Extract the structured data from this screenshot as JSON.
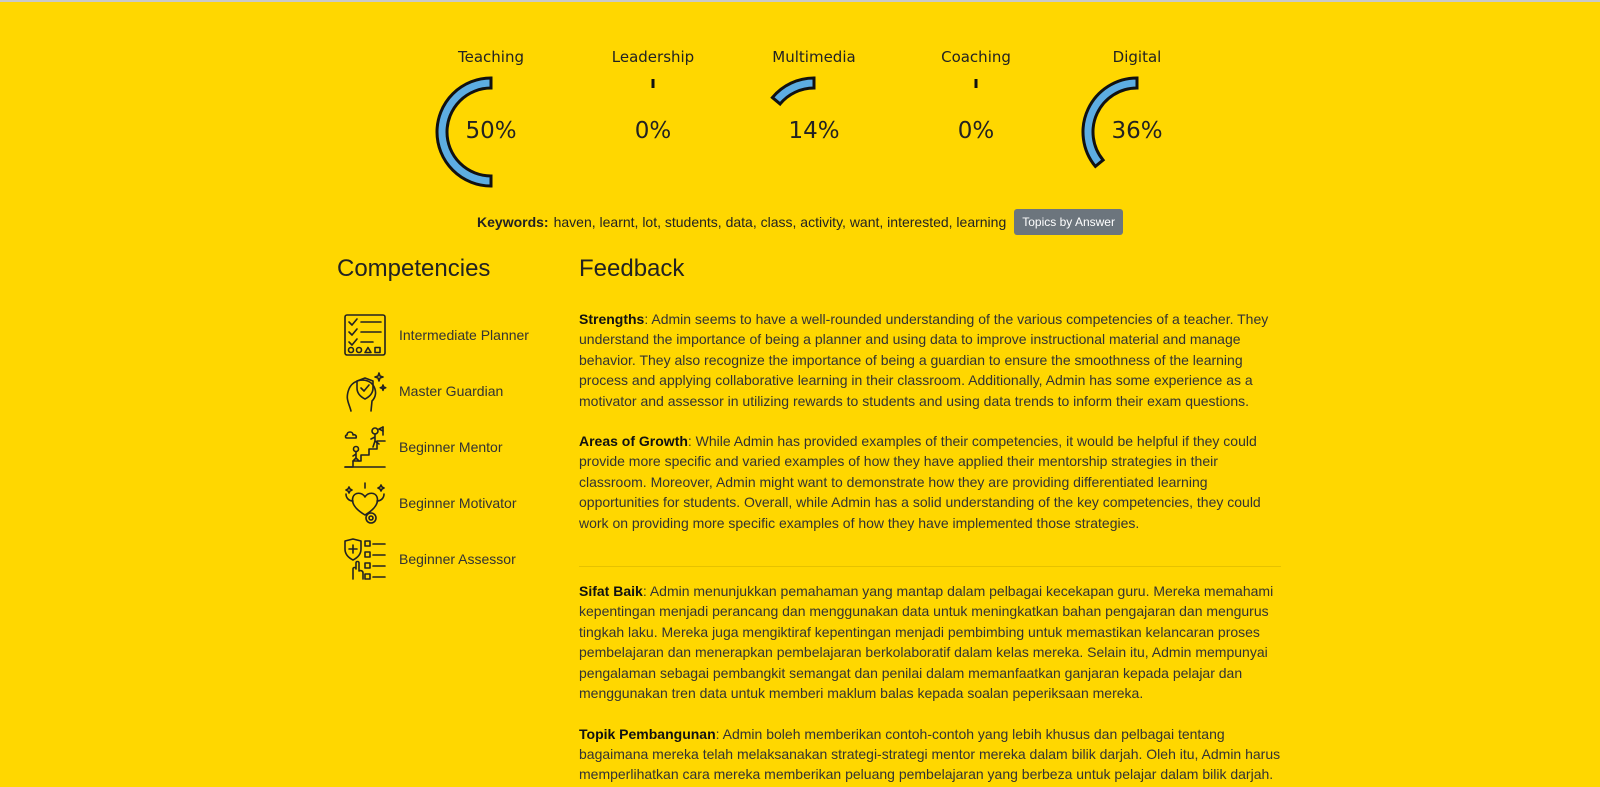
{
  "gauges": [
    {
      "label": "Teaching",
      "value_text": "50%",
      "percent": 50
    },
    {
      "label": "Leadership",
      "value_text": "0%",
      "percent": 0
    },
    {
      "label": "Multimedia",
      "value_text": "14%",
      "percent": 14
    },
    {
      "label": "Coaching",
      "value_text": "0%",
      "percent": 0
    },
    {
      "label": "Digital",
      "value_text": "36%",
      "percent": 36
    }
  ],
  "keywords": {
    "label": "Keywords:",
    "text": "haven, learnt, lot, students, data, class, activity, want, interested, learning",
    "button_label": "Topics by Answer"
  },
  "competencies": {
    "title": "Competencies",
    "items": [
      {
        "label": "Intermediate Planner",
        "icon": "planner-checklist-icon"
      },
      {
        "label": "Master Guardian",
        "icon": "guardian-shield-icon"
      },
      {
        "label": "Beginner Mentor",
        "icon": "mentor-climb-icon"
      },
      {
        "label": "Beginner Motivator",
        "icon": "motivator-icon"
      },
      {
        "label": "Beginner Assessor",
        "icon": "assessor-checklist-icon"
      }
    ]
  },
  "feedback": {
    "title": "Feedback",
    "strengths_label": "Strengths",
    "strengths_text": ": Admin seems to have a well-rounded understanding of the various competencies of a teacher. They understand the importance of being a planner and using data to improve instructional material and manage behavior. They also recognize the importance of being a guardian to ensure the smoothness of the learning process and applying collaborative learning in their classroom. Additionally, Admin has some experience as a motivator and assessor in utilizing rewards to students and using data trends to inform their exam questions.",
    "growth_label": "Areas of Growth",
    "growth_text": ": While Admin has provided examples of their competencies, it would be helpful if they could provide more specific and varied examples of how they have applied their mentorship strategies in their classroom. Moreover, Admin might want to demonstrate how they are providing differentiated learning opportunities for students. Overall, while Admin has a solid understanding of the key competencies, they could work on providing more specific examples of how they have implemented those strategies.",
    "sifat_label": "Sifat Baik",
    "sifat_text": ": Admin menunjukkan pemahaman yang mantap dalam pelbagai kecekapan guru. Mereka memahami kepentingan menjadi perancang dan menggunakan data untuk meningkatkan bahan pengajaran dan mengurus tingkah laku. Mereka juga mengiktiraf kepentingan menjadi pembimbing untuk memastikan kelancaran proses pembelajaran dan menerapkan pembelajaran berkolaboratif dalam kelas mereka. Selain itu, Admin mempunyai pengalaman sebagai pembangkit semangat dan penilai dalam memanfaatkan ganjaran kepada pelajar dan menggunakan tren data untuk memberi maklum balas kepada soalan peperiksaan mereka.",
    "topik_label": "Topik Pembangunan",
    "topik_text": ": Admin boleh memberikan contoh-contoh yang lebih khusus dan pelbagai tentang bagaimana mereka telah melaksanakan strategi-strategi mentor mereka dalam bilik darjah. Oleh itu, Admin harus memperlihatkan cara mereka memberikan peluang pembelajaran yang berbeza untuk pelajar dalam bilik darjah."
  },
  "colors": {
    "background": "#FFD700",
    "gauge_fill": "#5DADE2",
    "gauge_stroke": "#111111",
    "button": "#6c757d"
  }
}
